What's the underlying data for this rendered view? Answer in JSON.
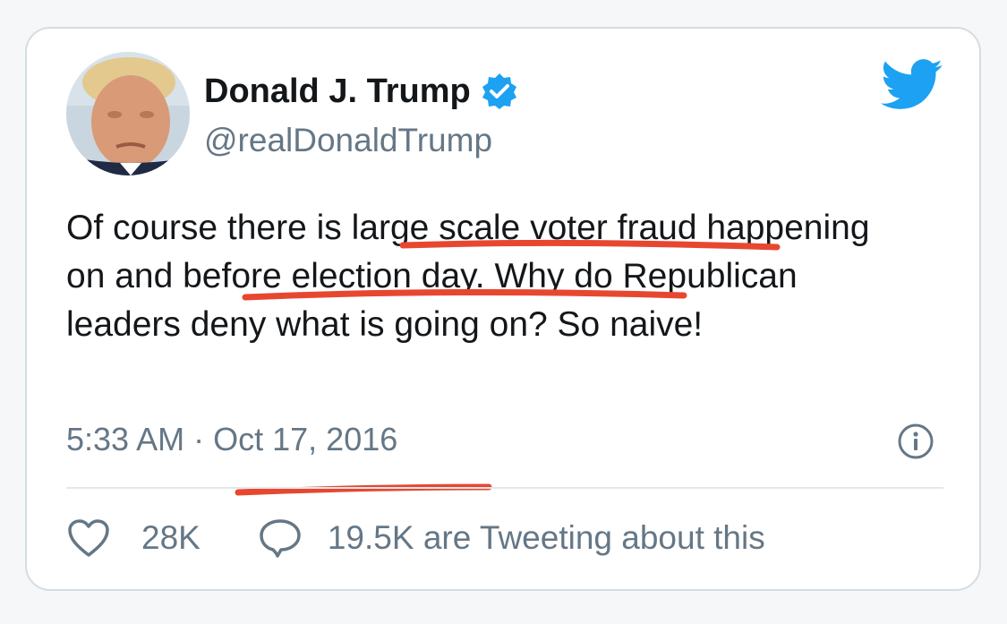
{
  "tweet": {
    "author": {
      "display_name": "Donald J. Trump",
      "handle": "@realDonaldTrump",
      "verified": true,
      "avatar_icon": "profile-photo"
    },
    "text_parts": [
      "Of course there is ",
      "large scale voter fraud",
      " happening ",
      "on and before election day",
      ". Why do Republican leaders deny what is going on? So naive!"
    ],
    "time": "5:33 AM",
    "separator": "·",
    "date": "Oct 17, 2016",
    "likes": "28K",
    "tweeting_label": "19.5K are Tweeting about this"
  },
  "icons": {
    "brand": "twitter-bird-icon",
    "verified": "verified-badge-icon",
    "info": "info-icon",
    "like": "heart-icon",
    "reply": "speech-bubble-icon"
  },
  "colors": {
    "brand_blue": "#1da1f2",
    "text_primary": "#14171a",
    "text_secondary": "#657786",
    "annotation_red": "#e8472f"
  }
}
